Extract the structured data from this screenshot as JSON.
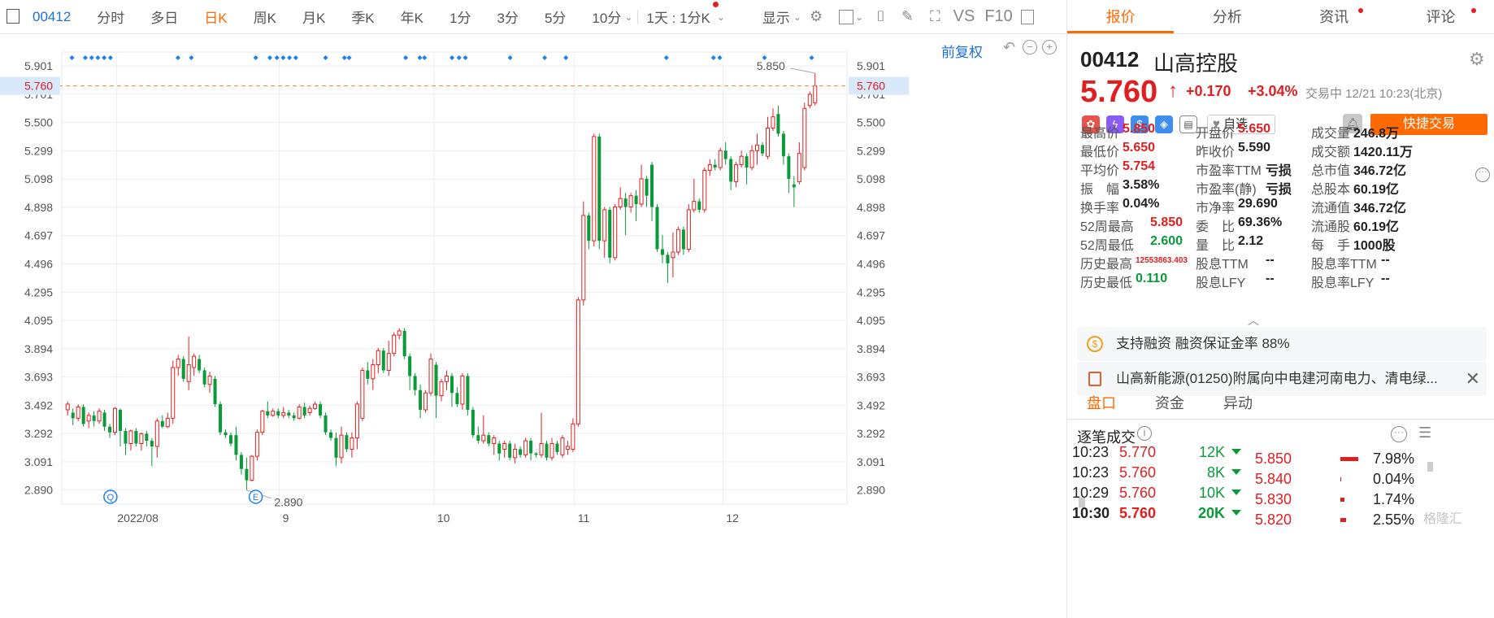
{
  "toolbar": {
    "code": "00412",
    "tabs": [
      "分时",
      "多日",
      "日K",
      "周K",
      "月K",
      "季K",
      "年K",
      "1分",
      "3分",
      "5分",
      "10分"
    ],
    "active_tab": "日K",
    "period_select": "1天 : 1分K",
    "display_label": "显示",
    "vs_label": "VS",
    "f10_label": "F10",
    "fuquan_label": "前复权"
  },
  "colors": {
    "up": "#e02020",
    "down": "#0b9a3a",
    "accent": "#ff6a00",
    "link": "#1e6fd8",
    "grid": "#eceef2"
  },
  "chart_data": {
    "type": "candlestick",
    "y_ticks": [
      "5.901",
      "5.701",
      "5.500",
      "5.299",
      "5.098",
      "4.898",
      "4.697",
      "4.496",
      "4.295",
      "4.095",
      "3.894",
      "3.693",
      "3.492",
      "3.292",
      "3.091",
      "2.890"
    ],
    "ylim": [
      2.79,
      6.0
    ],
    "x_ticks": [
      "2022/08",
      "9",
      "10",
      "11",
      "12"
    ],
    "current_price_label": "5.760",
    "high_label": "5.850",
    "low_label": "2.890",
    "candles": [
      [
        3.46,
        3.5,
        3.42,
        3.52
      ],
      [
        3.44,
        3.4,
        3.35,
        3.47
      ],
      [
        3.4,
        3.48,
        3.38,
        3.5
      ],
      [
        3.48,
        3.36,
        3.34,
        3.5
      ],
      [
        3.38,
        3.42,
        3.33,
        3.44
      ],
      [
        3.42,
        3.38,
        3.34,
        3.45
      ],
      [
        3.38,
        3.45,
        3.36,
        3.47
      ],
      [
        3.44,
        3.34,
        3.31,
        3.46
      ],
      [
        3.34,
        3.3,
        3.26,
        3.36
      ],
      [
        3.3,
        3.47,
        3.28,
        3.48
      ],
      [
        3.46,
        3.31,
        3.2,
        3.47
      ],
      [
        3.31,
        3.22,
        3.14,
        3.33
      ],
      [
        3.22,
        3.31,
        3.17,
        3.32
      ],
      [
        3.31,
        3.22,
        3.2,
        3.33
      ],
      [
        3.22,
        3.29,
        3.17,
        3.3
      ],
      [
        3.29,
        3.24,
        3.2,
        3.31
      ],
      [
        3.24,
        3.2,
        3.06,
        3.26
      ],
      [
        3.2,
        3.38,
        3.12,
        3.4
      ],
      [
        3.38,
        3.34,
        3.33,
        3.42
      ],
      [
        3.34,
        3.4,
        3.33,
        3.44
      ],
      [
        3.4,
        3.76,
        3.36,
        3.81
      ],
      [
        3.76,
        3.82,
        3.7,
        3.85
      ],
      [
        3.82,
        3.68,
        3.66,
        3.84
      ],
      [
        3.66,
        3.78,
        3.6,
        3.98
      ],
      [
        3.76,
        3.84,
        3.7,
        3.86
      ],
      [
        3.82,
        3.74,
        3.72,
        3.85
      ],
      [
        3.74,
        3.64,
        3.62,
        3.76
      ],
      [
        3.64,
        3.7,
        3.58,
        3.73
      ],
      [
        3.68,
        3.5,
        3.48,
        3.7
      ],
      [
        3.5,
        3.3,
        3.28,
        3.52
      ],
      [
        3.3,
        3.28,
        3.26,
        3.32
      ],
      [
        3.28,
        3.22,
        3.2,
        3.3
      ],
      [
        3.28,
        3.14,
        3.1,
        3.34
      ],
      [
        3.14,
        3.04,
        3.0,
        3.16
      ],
      [
        3.04,
        2.96,
        2.89,
        3.12
      ],
      [
        2.96,
        3.13,
        2.95,
        3.14
      ],
      [
        3.13,
        3.3,
        3.1,
        3.32
      ],
      [
        3.3,
        3.45,
        3.28,
        3.46
      ],
      [
        3.45,
        3.42,
        3.4,
        3.52
      ],
      [
        3.42,
        3.45,
        3.41,
        3.47
      ],
      [
        3.45,
        3.42,
        3.4,
        3.47
      ],
      [
        3.42,
        3.44,
        3.4,
        3.48
      ],
      [
        3.44,
        3.42,
        3.4,
        3.46
      ],
      [
        3.42,
        3.4,
        3.38,
        3.44
      ],
      [
        3.4,
        3.48,
        3.39,
        3.5
      ],
      [
        3.48,
        3.42,
        3.4,
        3.51
      ],
      [
        3.44,
        3.47,
        3.42,
        3.49
      ],
      [
        3.47,
        3.5,
        3.46,
        3.52
      ],
      [
        3.5,
        3.42,
        3.4,
        3.52
      ],
      [
        3.42,
        3.3,
        3.28,
        3.44
      ],
      [
        3.3,
        3.26,
        3.24,
        3.32
      ],
      [
        3.26,
        3.12,
        3.06,
        3.3
      ],
      [
        3.12,
        3.28,
        3.08,
        3.34
      ],
      [
        3.28,
        3.18,
        3.16,
        3.3
      ],
      [
        3.18,
        3.26,
        3.12,
        3.3
      ],
      [
        3.26,
        3.5,
        3.18,
        3.52
      ],
      [
        3.4,
        3.74,
        3.38,
        3.76
      ],
      [
        3.74,
        3.68,
        3.64,
        3.8
      ],
      [
        3.68,
        3.78,
        3.6,
        3.82
      ],
      [
        3.78,
        3.88,
        3.72,
        3.9
      ],
      [
        3.88,
        3.74,
        3.72,
        3.9
      ],
      [
        3.74,
        3.86,
        3.7,
        3.95
      ],
      [
        3.86,
        3.99,
        3.84,
        4.01
      ],
      [
        3.99,
        4.02,
        3.96,
        4.04
      ],
      [
        4.02,
        3.84,
        3.82,
        4.04
      ],
      [
        3.84,
        3.7,
        3.6,
        3.86
      ],
      [
        3.7,
        3.6,
        3.56,
        3.72
      ],
      [
        3.6,
        3.46,
        3.4,
        3.64
      ],
      [
        3.46,
        3.58,
        3.44,
        3.6
      ],
      [
        3.58,
        3.82,
        3.56,
        3.86
      ],
      [
        3.78,
        3.56,
        3.4,
        3.8
      ],
      [
        3.56,
        3.66,
        3.52,
        3.68
      ],
      [
        3.66,
        3.7,
        3.6,
        3.74
      ],
      [
        3.7,
        3.58,
        3.48,
        3.72
      ],
      [
        3.58,
        3.5,
        3.48,
        3.62
      ],
      [
        3.5,
        3.7,
        3.46,
        3.72
      ],
      [
        3.7,
        3.46,
        3.42,
        3.72
      ],
      [
        3.46,
        3.28,
        3.26,
        3.48
      ],
      [
        3.28,
        3.24,
        3.22,
        3.34
      ],
      [
        3.24,
        3.28,
        3.22,
        3.42
      ],
      [
        3.28,
        3.22,
        3.2,
        3.3
      ],
      [
        3.22,
        3.26,
        3.14,
        3.28
      ],
      [
        3.22,
        3.15,
        3.1,
        3.24
      ],
      [
        3.18,
        3.22,
        3.12,
        3.24
      ],
      [
        3.22,
        3.12,
        3.1,
        3.24
      ],
      [
        3.12,
        3.18,
        3.08,
        3.22
      ],
      [
        3.18,
        3.14,
        3.12,
        3.2
      ],
      [
        3.14,
        3.24,
        3.12,
        3.26
      ],
      [
        3.24,
        3.15,
        3.1,
        3.26
      ],
      [
        3.15,
        3.14,
        3.12,
        3.16
      ],
      [
        3.14,
        3.22,
        3.12,
        3.44
      ],
      [
        3.22,
        3.12,
        3.1,
        3.24
      ],
      [
        3.12,
        3.22,
        3.1,
        3.26
      ],
      [
        3.22,
        3.16,
        3.14,
        3.24
      ],
      [
        3.14,
        3.26,
        3.12,
        3.28
      ],
      [
        3.18,
        3.2,
        3.14,
        3.24
      ],
      [
        3.18,
        3.36,
        3.16,
        3.4
      ],
      [
        3.36,
        4.24,
        3.34,
        4.26
      ],
      [
        4.24,
        4.84,
        4.2,
        4.94
      ],
      [
        4.84,
        4.66,
        4.6,
        4.86
      ],
      [
        4.66,
        5.4,
        4.62,
        5.42
      ],
      [
        5.4,
        4.66,
        4.6,
        5.42
      ],
      [
        4.66,
        4.88,
        4.54,
        4.9
      ],
      [
        4.88,
        4.54,
        4.5,
        4.9
      ],
      [
        4.54,
        4.9,
        4.52,
        4.92
      ],
      [
        4.9,
        4.96,
        4.88,
        5.04
      ],
      [
        4.96,
        4.9,
        4.7,
        5.0
      ],
      [
        4.9,
        4.98,
        4.86,
        5.0
      ],
      [
        4.98,
        4.92,
        4.8,
        5.02
      ],
      [
        4.92,
        5.1,
        4.9,
        5.2
      ],
      [
        5.1,
        4.98,
        4.9,
        5.12
      ],
      [
        5.2,
        4.9,
        4.8,
        5.22
      ],
      [
        4.9,
        4.6,
        4.58,
        4.92
      ],
      [
        4.6,
        4.56,
        4.5,
        4.7
      ],
      [
        4.56,
        4.5,
        4.36,
        4.58
      ],
      [
        4.54,
        4.58,
        4.4,
        4.72
      ],
      [
        4.58,
        4.74,
        4.56,
        4.76
      ],
      [
        4.74,
        4.6,
        4.56,
        4.76
      ],
      [
        4.6,
        4.88,
        4.58,
        4.92
      ],
      [
        4.88,
        4.94,
        4.86,
        5.1
      ],
      [
        4.94,
        4.88,
        4.86,
        4.96
      ],
      [
        4.88,
        5.16,
        4.86,
        5.18
      ],
      [
        5.16,
        5.2,
        5.12,
        5.24
      ],
      [
        5.2,
        5.18,
        5.16,
        5.24
      ],
      [
        5.18,
        5.3,
        5.16,
        5.32
      ],
      [
        5.3,
        5.24,
        5.2,
        5.36
      ],
      [
        5.24,
        5.08,
        5.02,
        5.26
      ],
      [
        5.08,
        5.2,
        5.04,
        5.22
      ],
      [
        5.2,
        5.26,
        5.18,
        5.3
      ],
      [
        5.26,
        5.18,
        5.06,
        5.28
      ],
      [
        5.18,
        5.3,
        5.16,
        5.34
      ],
      [
        5.3,
        5.34,
        5.2,
        5.42
      ],
      [
        5.34,
        5.28,
        5.26,
        5.36
      ],
      [
        5.26,
        5.46,
        5.24,
        5.54
      ],
      [
        5.46,
        5.54,
        5.44,
        5.6
      ],
      [
        5.56,
        5.42,
        5.4,
        5.62
      ],
      [
        5.42,
        5.26,
        5.2,
        5.44
      ],
      [
        5.26,
        5.1,
        5.0,
        5.28
      ],
      [
        5.06,
        5.04,
        4.9,
        5.12
      ],
      [
        5.08,
        5.28,
        5.06,
        5.36
      ],
      [
        5.18,
        5.6,
        5.16,
        5.64
      ],
      [
        5.62,
        5.7,
        5.6,
        5.72
      ],
      [
        5.64,
        5.76,
        5.62,
        5.85
      ]
    ],
    "markers": [
      [
        "Q",
        0.062
      ],
      [
        "E",
        0.247
      ]
    ]
  },
  "quote": {
    "code": "00412",
    "name": "山高控股",
    "price": "5.760",
    "arrow": "↑",
    "change": "+0.170",
    "change_pct": "+3.04%",
    "status": "交易中 12/21 10:23(北京)",
    "watch_label": "自选",
    "fast_trade_label": "快捷交易"
  },
  "stats": [
    [
      "最高价",
      "5.850",
      "red"
    ],
    [
      "开盘价",
      "5.650",
      "red"
    ],
    [
      "成交量",
      "246.8万",
      ""
    ],
    [
      "最低价",
      "5.650",
      "red"
    ],
    [
      "昨收价",
      "5.590",
      ""
    ],
    [
      "成交额",
      "1420.11万",
      ""
    ],
    [
      "平均价",
      "5.754",
      "red"
    ],
    [
      "市盈率TTM",
      "亏损",
      ""
    ],
    [
      "总市值",
      "346.72亿",
      ""
    ],
    [
      "振　幅",
      "3.58%",
      ""
    ],
    [
      "市盈率(静)",
      "亏损",
      ""
    ],
    [
      "总股本",
      "60.19亿",
      ""
    ],
    [
      "换手率",
      "0.04%",
      ""
    ],
    [
      "市净率",
      "29.690",
      ""
    ],
    [
      "流通值",
      "346.72亿",
      ""
    ],
    [
      "52周最高",
      "5.850",
      "red"
    ],
    [
      "委　比",
      "69.36%",
      ""
    ],
    [
      "流通股",
      "60.19亿",
      ""
    ],
    [
      "52周最低",
      "2.600",
      "green"
    ],
    [
      "量　比",
      "2.12",
      ""
    ],
    [
      "每　手",
      "1000股",
      ""
    ],
    [
      "历史最高",
      "12553863.403",
      "red"
    ],
    [
      "股息TTM",
      "--",
      ""
    ],
    [
      "股息率TTM",
      "--",
      ""
    ],
    [
      "历史最低",
      "0.110",
      "green"
    ],
    [
      "股息LFY",
      "--",
      ""
    ],
    [
      "股息率LFY",
      "--",
      ""
    ]
  ],
  "right_tabs": [
    "报价",
    "分析",
    "资讯",
    "评论"
  ],
  "banners": {
    "margin": "支持融资 融资保证金率 88%",
    "news": "山高新能源(01250)附属向中电建河南电力、清电绿..."
  },
  "sub_tabs": [
    "盘口",
    "资金",
    "异动"
  ],
  "trades_title": "逐笔成交",
  "trades": [
    [
      "10:23",
      "5.770",
      "12K"
    ],
    [
      "10:23",
      "5.760",
      "8K"
    ],
    [
      "10:29",
      "5.760",
      "10K"
    ],
    [
      "10:30",
      "5.760",
      "20K"
    ]
  ],
  "orderbook": [
    [
      "5.850",
      "7.98%"
    ],
    [
      "5.840",
      "0.04%"
    ],
    [
      "5.830",
      "1.74%"
    ],
    [
      "5.820",
      "2.55%"
    ]
  ],
  "watermark": "格隆汇"
}
